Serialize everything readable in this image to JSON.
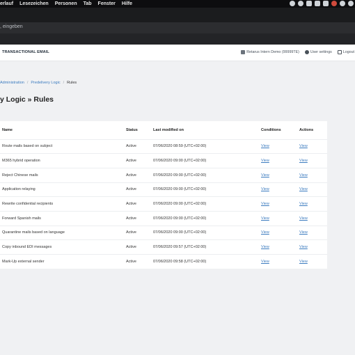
{
  "menubar": {
    "items": [
      "erlauf",
      "Lesezeichen",
      "Personen",
      "Tab",
      "Fenster",
      "Hilfe"
    ]
  },
  "browser": {
    "address_placeholder": ", eingeben"
  },
  "header": {
    "brand": "TRANSACTIONAL EMAIL",
    "account": "Retarus Intern Demo (99999TE)",
    "user_settings": "User settings",
    "logout": "Logout"
  },
  "breadcrumb": {
    "items": [
      "Administration",
      "Predelivery Logic",
      "Rules"
    ],
    "separator": "/"
  },
  "page": {
    "title": "y Logic » Rules"
  },
  "table": {
    "headers": [
      "Name",
      "Status",
      "Last modified on",
      "Conditions",
      "Actions"
    ],
    "rows": [
      {
        "name": "Route mails based on subject",
        "status": "Active",
        "modified": "07/06/2020 08:59 (UTC+02:00)",
        "conditions": "View",
        "actions": "View"
      },
      {
        "name": "M365 hybrid operation",
        "status": "Active",
        "modified": "07/06/2020 09:00 (UTC+02:00)",
        "conditions": "View",
        "actions": "View"
      },
      {
        "name": "Reject Chinese mails",
        "status": "Active",
        "modified": "07/06/2020 09:00 (UTC+02:00)",
        "conditions": "View",
        "actions": "View"
      },
      {
        "name": "Application relaying",
        "status": "Active",
        "modified": "07/06/2020 09:00 (UTC+02:00)",
        "conditions": "View",
        "actions": "View"
      },
      {
        "name": "Rewrite confidential recipients",
        "status": "Active",
        "modified": "07/06/2020 09:00 (UTC+02:00)",
        "conditions": "View",
        "actions": "View"
      },
      {
        "name": "Forward Spanish mails",
        "status": "Active",
        "modified": "07/06/2020 09:00 (UTC+02:00)",
        "conditions": "View",
        "actions": "View"
      },
      {
        "name": "Quarantine mails based on language",
        "status": "Active",
        "modified": "07/06/2020 09:00 (UTC+02:00)",
        "conditions": "View",
        "actions": "View"
      },
      {
        "name": "Copy inbound EDI messages",
        "status": "Active",
        "modified": "07/06/2020 09:57 (UTC+02:00)",
        "conditions": "View",
        "actions": "View"
      },
      {
        "name": "Mark-Up external sender",
        "status": "Active",
        "modified": "07/06/2020 09:58 (UTC+02:00)",
        "conditions": "View",
        "actions": "View"
      }
    ]
  },
  "colors": {
    "link": "#3b7bbf",
    "page_bg": "#f0f1f3",
    "menubar_bg": "#0d0d0f"
  }
}
